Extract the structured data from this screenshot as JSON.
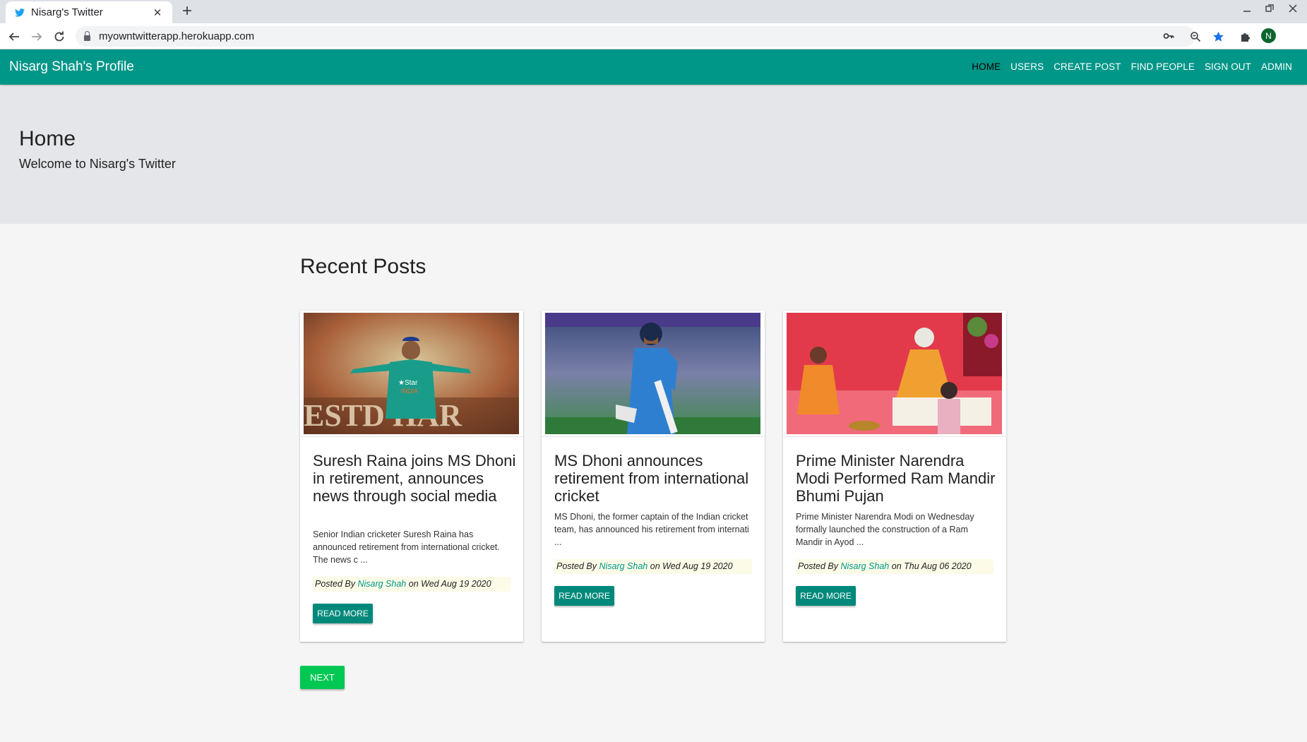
{
  "browser": {
    "tab_title": "Nisarg's Twitter",
    "tab_close": "✕",
    "new_tab": "+",
    "url": "myowntwitterapp.herokuapp.com",
    "profile_initial": "N"
  },
  "app": {
    "brand": "Nisarg Shah's Profile",
    "nav": [
      "HOME",
      "USERS",
      "CREATE POST",
      "FIND PEOPLE",
      "SIGN OUT",
      "ADMIN"
    ],
    "active_nav": "HOME"
  },
  "hero": {
    "title": "Home",
    "subtitle": "Welcome to Nisarg's Twitter"
  },
  "section_title": "Recent Posts",
  "posts": [
    {
      "title": "Suresh Raina joins MS Dhoni in retirement, announces news through social media",
      "excerpt": "Senior Indian cricketer Suresh Raina has announced retirement from international cricket. The news c ...",
      "posted_by_label": "Posted By",
      "author": "Nisarg Shah",
      "on_label": "on",
      "date": "Wed Aug 19 2020",
      "button": "READ MORE"
    },
    {
      "title": "MS Dhoni announces retirement from international cricket",
      "excerpt": "MS Dhoni, the former captain of the Indian cricket team, has announced his retirement from internati ...",
      "posted_by_label": "Posted By",
      "author": "Nisarg Shah",
      "on_label": "on",
      "date": "Wed Aug 19 2020",
      "button": "READ MORE"
    },
    {
      "title": "Prime Minister Narendra Modi Performed Ram Mandir Bhumi Pujan",
      "excerpt": "Prime Minister Narendra Modi on Wednesday formally launched the construction of a Ram Mandir in Ayod ...",
      "posted_by_label": "Posted By",
      "author": "Nisarg Shah",
      "on_label": "on",
      "date": "Thu Aug 06 2020",
      "button": "READ MORE"
    }
  ],
  "next_button": "NEXT",
  "colors": {
    "primary": "#009688",
    "button": "#00897b",
    "next": "#00c853",
    "hero_bg": "#e4e6e9"
  }
}
